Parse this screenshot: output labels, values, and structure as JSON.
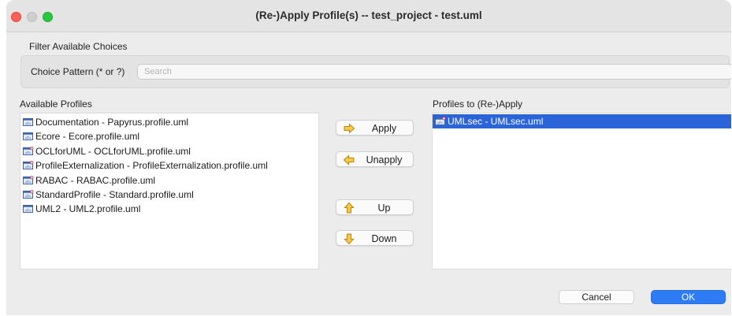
{
  "window": {
    "title": "(Re-)Apply Profile(s) -- test_project - test.uml"
  },
  "filter": {
    "section_label": "Filter Available Choices",
    "choice_label": "Choice Pattern (* or ?)",
    "placeholder": "Search",
    "value": ""
  },
  "available": {
    "label": "Available Profiles",
    "items": [
      {
        "label": "Documentation - Papyrus.profile.uml",
        "icon": "profile-icon"
      },
      {
        "label": "Ecore - Ecore.profile.uml",
        "icon": "profile-icon"
      },
      {
        "label": "OCLforUML - OCLforUML.profile.uml",
        "icon": "profile-plus-icon"
      },
      {
        "label": "ProfileExternalization - ProfileExternalization.profile.uml",
        "icon": "profile-plus-icon"
      },
      {
        "label": "RABAC - RABAC.profile.uml",
        "icon": "profile-plus-icon"
      },
      {
        "label": "StandardProfile - Standard.profile.uml",
        "icon": "profile-plus-icon"
      },
      {
        "label": "UML2 - UML2.profile.uml",
        "icon": "profile-icon"
      }
    ]
  },
  "applied": {
    "label": "Profiles to (Re-)Apply",
    "items": [
      {
        "label": "UMLsec - UMLsec.uml",
        "icon": "profile-plus-icon",
        "selected": true
      }
    ]
  },
  "buttons": {
    "apply": "Apply",
    "unapply": "Unapply",
    "up": "Up",
    "down": "Down",
    "cancel": "Cancel",
    "ok": "OK"
  },
  "colors": {
    "selection": "#2b63d9",
    "ok_button": "#2d7cf6",
    "arrow_fill": "#f7c948",
    "arrow_stroke": "#b8860b"
  }
}
